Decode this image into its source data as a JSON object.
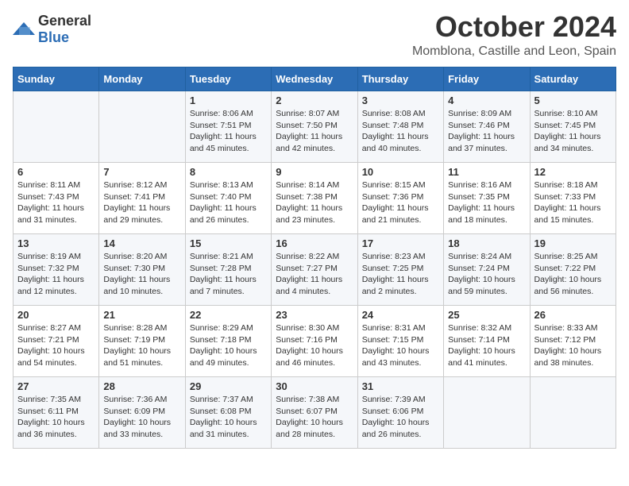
{
  "header": {
    "logo": {
      "general": "General",
      "blue": "Blue"
    },
    "month": "October 2024",
    "location": "Momblona, Castille and Leon, Spain"
  },
  "weekdays": [
    "Sunday",
    "Monday",
    "Tuesday",
    "Wednesday",
    "Thursday",
    "Friday",
    "Saturday"
  ],
  "weeks": [
    [
      {
        "day": "",
        "sunrise": "",
        "sunset": "",
        "daylight": ""
      },
      {
        "day": "",
        "sunrise": "",
        "sunset": "",
        "daylight": ""
      },
      {
        "day": "1",
        "sunrise": "Sunrise: 8:06 AM",
        "sunset": "Sunset: 7:51 PM",
        "daylight": "Daylight: 11 hours and 45 minutes."
      },
      {
        "day": "2",
        "sunrise": "Sunrise: 8:07 AM",
        "sunset": "Sunset: 7:50 PM",
        "daylight": "Daylight: 11 hours and 42 minutes."
      },
      {
        "day": "3",
        "sunrise": "Sunrise: 8:08 AM",
        "sunset": "Sunset: 7:48 PM",
        "daylight": "Daylight: 11 hours and 40 minutes."
      },
      {
        "day": "4",
        "sunrise": "Sunrise: 8:09 AM",
        "sunset": "Sunset: 7:46 PM",
        "daylight": "Daylight: 11 hours and 37 minutes."
      },
      {
        "day": "5",
        "sunrise": "Sunrise: 8:10 AM",
        "sunset": "Sunset: 7:45 PM",
        "daylight": "Daylight: 11 hours and 34 minutes."
      }
    ],
    [
      {
        "day": "6",
        "sunrise": "Sunrise: 8:11 AM",
        "sunset": "Sunset: 7:43 PM",
        "daylight": "Daylight: 11 hours and 31 minutes."
      },
      {
        "day": "7",
        "sunrise": "Sunrise: 8:12 AM",
        "sunset": "Sunset: 7:41 PM",
        "daylight": "Daylight: 11 hours and 29 minutes."
      },
      {
        "day": "8",
        "sunrise": "Sunrise: 8:13 AM",
        "sunset": "Sunset: 7:40 PM",
        "daylight": "Daylight: 11 hours and 26 minutes."
      },
      {
        "day": "9",
        "sunrise": "Sunrise: 8:14 AM",
        "sunset": "Sunset: 7:38 PM",
        "daylight": "Daylight: 11 hours and 23 minutes."
      },
      {
        "day": "10",
        "sunrise": "Sunrise: 8:15 AM",
        "sunset": "Sunset: 7:36 PM",
        "daylight": "Daylight: 11 hours and 21 minutes."
      },
      {
        "day": "11",
        "sunrise": "Sunrise: 8:16 AM",
        "sunset": "Sunset: 7:35 PM",
        "daylight": "Daylight: 11 hours and 18 minutes."
      },
      {
        "day": "12",
        "sunrise": "Sunrise: 8:18 AM",
        "sunset": "Sunset: 7:33 PM",
        "daylight": "Daylight: 11 hours and 15 minutes."
      }
    ],
    [
      {
        "day": "13",
        "sunrise": "Sunrise: 8:19 AM",
        "sunset": "Sunset: 7:32 PM",
        "daylight": "Daylight: 11 hours and 12 minutes."
      },
      {
        "day": "14",
        "sunrise": "Sunrise: 8:20 AM",
        "sunset": "Sunset: 7:30 PM",
        "daylight": "Daylight: 11 hours and 10 minutes."
      },
      {
        "day": "15",
        "sunrise": "Sunrise: 8:21 AM",
        "sunset": "Sunset: 7:28 PM",
        "daylight": "Daylight: 11 hours and 7 minutes."
      },
      {
        "day": "16",
        "sunrise": "Sunrise: 8:22 AM",
        "sunset": "Sunset: 7:27 PM",
        "daylight": "Daylight: 11 hours and 4 minutes."
      },
      {
        "day": "17",
        "sunrise": "Sunrise: 8:23 AM",
        "sunset": "Sunset: 7:25 PM",
        "daylight": "Daylight: 11 hours and 2 minutes."
      },
      {
        "day": "18",
        "sunrise": "Sunrise: 8:24 AM",
        "sunset": "Sunset: 7:24 PM",
        "daylight": "Daylight: 10 hours and 59 minutes."
      },
      {
        "day": "19",
        "sunrise": "Sunrise: 8:25 AM",
        "sunset": "Sunset: 7:22 PM",
        "daylight": "Daylight: 10 hours and 56 minutes."
      }
    ],
    [
      {
        "day": "20",
        "sunrise": "Sunrise: 8:27 AM",
        "sunset": "Sunset: 7:21 PM",
        "daylight": "Daylight: 10 hours and 54 minutes."
      },
      {
        "day": "21",
        "sunrise": "Sunrise: 8:28 AM",
        "sunset": "Sunset: 7:19 PM",
        "daylight": "Daylight: 10 hours and 51 minutes."
      },
      {
        "day": "22",
        "sunrise": "Sunrise: 8:29 AM",
        "sunset": "Sunset: 7:18 PM",
        "daylight": "Daylight: 10 hours and 49 minutes."
      },
      {
        "day": "23",
        "sunrise": "Sunrise: 8:30 AM",
        "sunset": "Sunset: 7:16 PM",
        "daylight": "Daylight: 10 hours and 46 minutes."
      },
      {
        "day": "24",
        "sunrise": "Sunrise: 8:31 AM",
        "sunset": "Sunset: 7:15 PM",
        "daylight": "Daylight: 10 hours and 43 minutes."
      },
      {
        "day": "25",
        "sunrise": "Sunrise: 8:32 AM",
        "sunset": "Sunset: 7:14 PM",
        "daylight": "Daylight: 10 hours and 41 minutes."
      },
      {
        "day": "26",
        "sunrise": "Sunrise: 8:33 AM",
        "sunset": "Sunset: 7:12 PM",
        "daylight": "Daylight: 10 hours and 38 minutes."
      }
    ],
    [
      {
        "day": "27",
        "sunrise": "Sunrise: 7:35 AM",
        "sunset": "Sunset: 6:11 PM",
        "daylight": "Daylight: 10 hours and 36 minutes."
      },
      {
        "day": "28",
        "sunrise": "Sunrise: 7:36 AM",
        "sunset": "Sunset: 6:09 PM",
        "daylight": "Daylight: 10 hours and 33 minutes."
      },
      {
        "day": "29",
        "sunrise": "Sunrise: 7:37 AM",
        "sunset": "Sunset: 6:08 PM",
        "daylight": "Daylight: 10 hours and 31 minutes."
      },
      {
        "day": "30",
        "sunrise": "Sunrise: 7:38 AM",
        "sunset": "Sunset: 6:07 PM",
        "daylight": "Daylight: 10 hours and 28 minutes."
      },
      {
        "day": "31",
        "sunrise": "Sunrise: 7:39 AM",
        "sunset": "Sunset: 6:06 PM",
        "daylight": "Daylight: 10 hours and 26 minutes."
      },
      {
        "day": "",
        "sunrise": "",
        "sunset": "",
        "daylight": ""
      },
      {
        "day": "",
        "sunrise": "",
        "sunset": "",
        "daylight": ""
      }
    ]
  ]
}
